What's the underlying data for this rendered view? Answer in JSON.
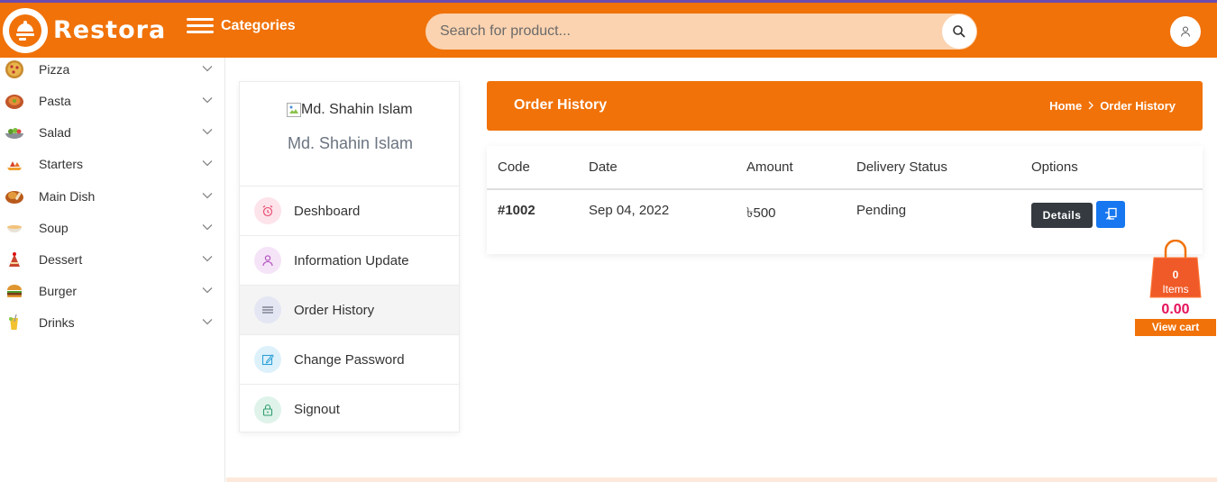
{
  "header": {
    "brand": "Restora",
    "categories_label": "Categories",
    "search_placeholder": "Search for product...",
    "accent_color": "#f07209"
  },
  "sidebar": {
    "items": [
      {
        "label": "Pizza",
        "icon": "pizza-icon"
      },
      {
        "label": "Pasta",
        "icon": "pasta-icon"
      },
      {
        "label": "Salad",
        "icon": "salad-icon"
      },
      {
        "label": "Starters",
        "icon": "starters-icon"
      },
      {
        "label": "Main Dish",
        "icon": "main-dish-icon"
      },
      {
        "label": "Soup",
        "icon": "soup-icon"
      },
      {
        "label": "Dessert",
        "icon": "dessert-icon"
      },
      {
        "label": "Burger",
        "icon": "burger-icon"
      },
      {
        "label": "Drinks",
        "icon": "drinks-icon"
      }
    ]
  },
  "profile": {
    "image_alt": "Md. Shahin Islam",
    "name": "Md. Shahin Islam",
    "menu": [
      {
        "label": "Deshboard",
        "icon": "alarm-clock-icon",
        "active": false
      },
      {
        "label": "Information Update",
        "icon": "user-icon",
        "active": false
      },
      {
        "label": "Order History",
        "icon": "list-icon",
        "active": true
      },
      {
        "label": "Change Password",
        "icon": "edit-icon",
        "active": false
      },
      {
        "label": "Signout",
        "icon": "lock-icon",
        "active": false
      }
    ]
  },
  "page": {
    "title": "Order History",
    "breadcrumb": [
      "Home",
      "Order History"
    ]
  },
  "orders": {
    "columns": [
      "Code",
      "Date",
      "Amount",
      "Delivery Status",
      "Options"
    ],
    "rows": [
      {
        "code": "#1002",
        "date": "Sep 04, 2022",
        "amount": "৳500",
        "status": "Pending",
        "details_label": "Details"
      }
    ]
  },
  "cart": {
    "count": "0",
    "items_label": "Items",
    "total": "0.00",
    "view_label": "View cart"
  }
}
